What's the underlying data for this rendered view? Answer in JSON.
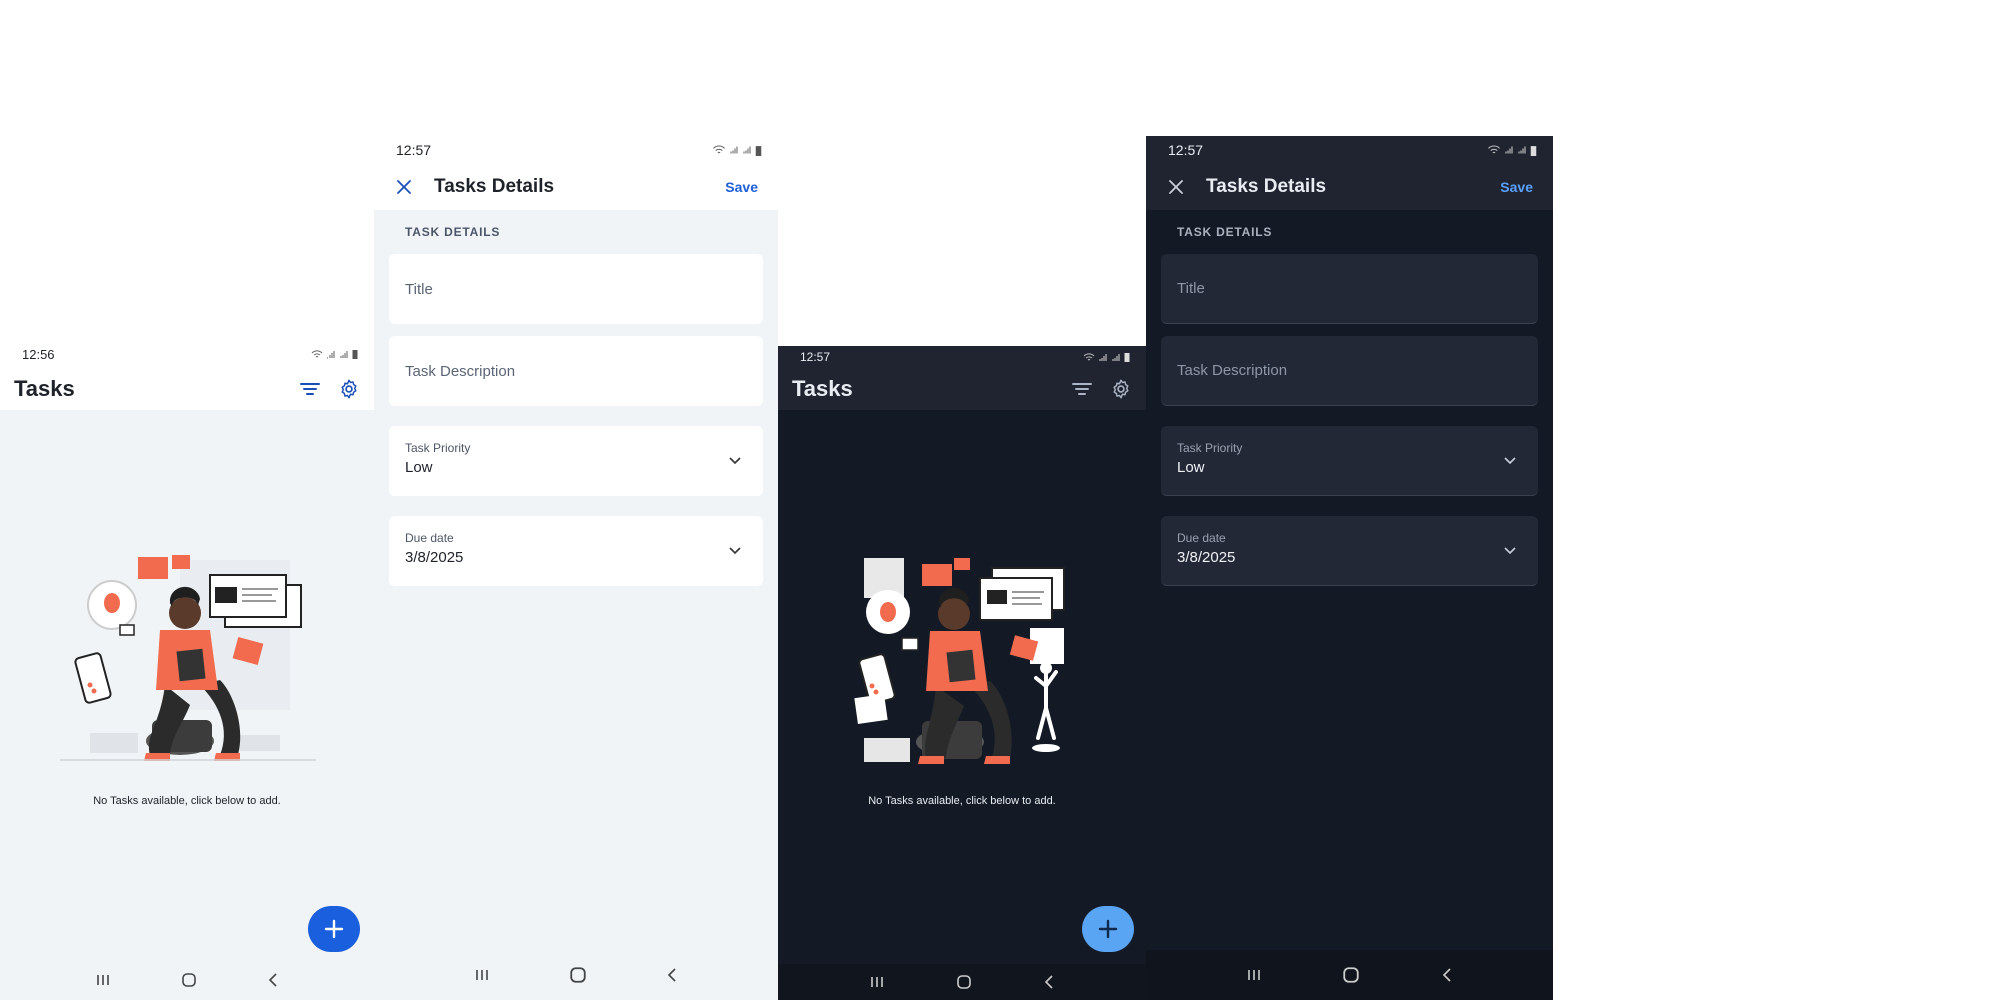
{
  "screens": {
    "home_light": {
      "time": "12:56",
      "title": "Tasks",
      "empty_message": "No Tasks available, click below to add."
    },
    "details_light": {
      "time": "12:57",
      "title": "Tasks Details",
      "save_label": "Save",
      "section_label": "TASK DETAILS",
      "title_placeholder": "Title",
      "description_placeholder": "Task Description",
      "priority_label": "Task Priority",
      "priority_value": "Low",
      "due_label": "Due date",
      "due_value": "3/8/2025"
    },
    "home_dark": {
      "time": "12:57",
      "title": "Tasks",
      "empty_message": "No Tasks available, click below to add."
    },
    "details_dark": {
      "time": "12:57",
      "title": "Tasks Details",
      "save_label": "Save",
      "section_label": "TASK DETAILS",
      "title_placeholder": "Title",
      "description_placeholder": "Task Description",
      "priority_label": "Task Priority",
      "priority_value": "Low",
      "due_label": "Due date",
      "due_value": "3/8/2025"
    }
  },
  "icons": {
    "filter": "filter-icon",
    "settings": "gear-icon",
    "close": "close-icon",
    "chevron": "chevron-down-icon",
    "add": "plus-icon",
    "recent_apps": "recent-apps-icon",
    "home": "home-icon",
    "back": "back-icon"
  },
  "colors": {
    "primary_light": "#1a5fde",
    "primary_dark": "#5aa4f4",
    "bg_light": "#f1f4f7",
    "bg_dark": "#131a25",
    "accent_orange": "#f26b4f"
  }
}
